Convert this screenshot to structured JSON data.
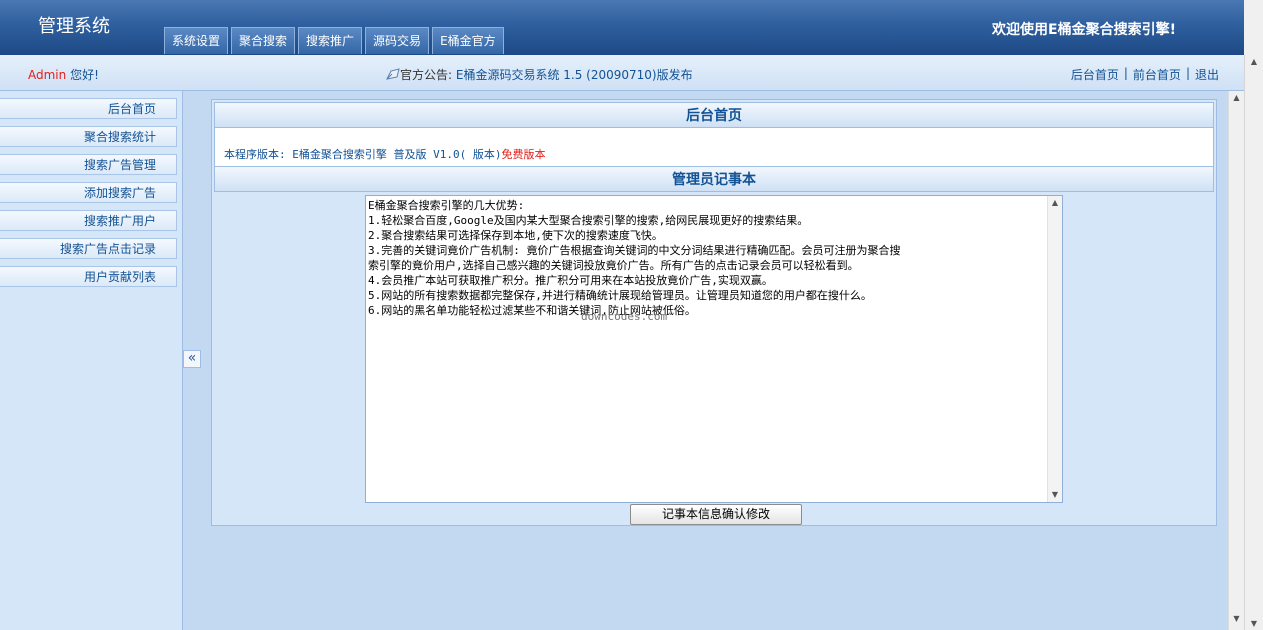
{
  "header": {
    "logo": "管理系统",
    "welcome": "欢迎使用E桶金聚合搜索引擎!",
    "tabs": [
      "系统设置",
      "聚合搜索",
      "搜索推广",
      "源码交易",
      "E桶金官方"
    ]
  },
  "subbar": {
    "admin_name": "Admin",
    "greeting": "您好!",
    "notice_label": "官方公告:",
    "notice_value": "E桶金源码交易系统 1.5 (20090710)版发布",
    "links": [
      "后台首页",
      "前台首页",
      "退出"
    ],
    "separator": "|"
  },
  "sidebar": {
    "items": [
      "后台首页",
      "聚合搜索统计",
      "搜索广告管理",
      "添加搜索广告",
      "搜索推广用户",
      "搜索广告点击记录",
      "用户贡献列表"
    ],
    "collapse_label": "«"
  },
  "main": {
    "title": "后台首页",
    "version_prefix": "本程序版本: E桶金聚合搜索引擎 普及版 V1.0( 版本)",
    "version_free": "免费版本",
    "notepad_title": "管理员记事本",
    "notepad_lines": [
      "E桶金聚合搜索引擎的几大优势:",
      "1.轻松聚合百度,Google及国内某大型聚合搜索引擎的搜索,给网民展现更好的搜索结果。",
      "2.聚合搜索结果可选择保存到本地,使下次的搜索速度飞快。",
      "3.完善的关键词竟价广告机制: 竟价广告根据查询关键词的中文分词结果进行精确匹配。会员可注册为聚合搜",
      "索引擎的竟价用户,选择自己感兴趣的关键词投放竟价广告。所有广告的点击记录会员可以轻松看到。",
      "4.会员推广本站可获取推广积分。推广积分可用来在本站投放竟价广告,实现双赢。",
      "5.网站的所有搜索数据都完整保存,并进行精确统计展现给管理员。让管理员知道您的用户都在搜什么。",
      "6.网站的黑名单功能轻松过滤某些不和谐关键词,防止网站被低俗。"
    ],
    "watermark": "downcodes.com",
    "confirm_button": "记事本信息确认修改"
  }
}
